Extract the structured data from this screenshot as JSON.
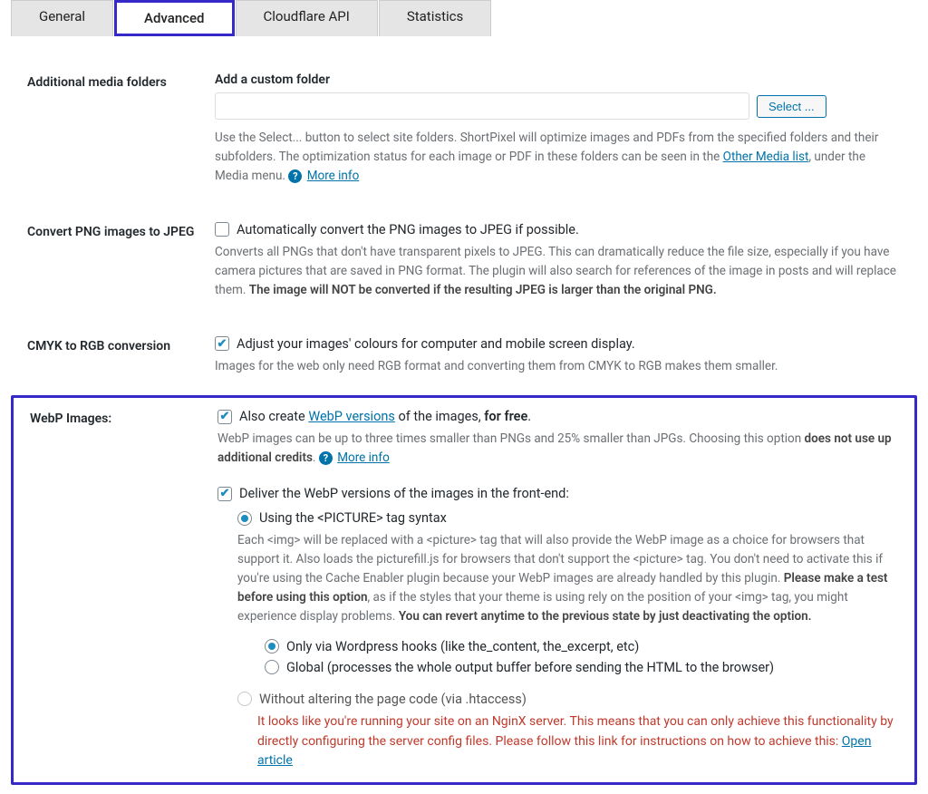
{
  "tabs": {
    "general": "General",
    "advanced": "Advanced",
    "cloudflare": "Cloudflare API",
    "statistics": "Statistics"
  },
  "folders": {
    "heading": "Additional media folders",
    "addLabel": "Add a custom folder",
    "placeholder": "",
    "selectBtn": "Select ...",
    "desc1": "Use the Select... button to select site folders. ShortPixel will optimize images and PDFs from the specified folders and their subfolders. The optimization status for each image or PDF in these folders can be seen in the ",
    "otherMediaLink": "Other Media list",
    "desc2": ", under the Media menu.  ",
    "moreInfo": "More info"
  },
  "png": {
    "heading": "Convert PNG images to JPEG",
    "checkboxLabel": "Automatically convert the PNG images to JPEG if possible.",
    "desc1": "Converts all PNGs that don't have transparent pixels to JPEG. This can dramatically reduce the file size, especially if you have camera pictures that are saved in PNG format. The plugin will also search for references of the image in posts and will replace them. ",
    "descBold": "The image will NOT be converted if the resulting JPEG is larger than the original PNG."
  },
  "cmyk": {
    "heading": "CMYK to RGB conversion",
    "checkboxLabel": "Adjust your images' colours for computer and mobile screen display.",
    "desc": "Images for the web only need RGB format and converting them from CMYK to RGB makes them smaller."
  },
  "webp": {
    "heading": "WebP Images:",
    "alsoCreate1": "Also create ",
    "alsoCreateLink": "WebP versions",
    "alsoCreate2": " of the images, ",
    "alsoCreateBold": "for free",
    "period": ".",
    "desc1": "WebP images can be up to three times smaller than PNGs and 25% smaller than JPGs. Choosing this option ",
    "descBold": "does not use up additional credits",
    "desc2": ".  ",
    "moreInfo": "More info",
    "deliverLabel": "Deliver the WebP versions of the images in the front-end:",
    "picture": {
      "label": "Using the <PICTURE> tag syntax",
      "d1": "Each <img> will be replaced with a <picture> tag that will also provide the WebP image as a choice for browsers that support it. Also loads the picturefill.js for browsers that don't support the <picture> tag. You don't need to activate this if you're using the Cache Enabler plugin because your WebP images are already handled by this plugin. ",
      "d1b": "Please make a test before using this option",
      "d2": ", as if the styles that your theme is using rely on the position of your <img> tag, you might experience display problems. ",
      "d2b": "You can revert anytime to the previous state by just deactivating the option.",
      "sub1": "Only via Wordpress hooks (like the_content, the_excerpt, etc)",
      "sub2": "Global (processes the whole output buffer before sending the HTML to the browser)"
    },
    "htaccess": {
      "label": "Without altering the page code (via .htaccess)",
      "warn": "It looks like you're running your site on an NginX server. This means that you can only achieve this functionality by directly configuring the server config files. Please follow this link for instructions on how to achieve this: ",
      "link": "Open article"
    }
  }
}
